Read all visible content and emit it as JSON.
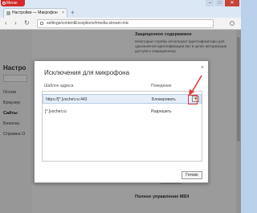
{
  "window": {
    "menu_label": "Меню",
    "min_glyph": "–",
    "max_glyph": "□",
    "close_glyph": "✕"
  },
  "tab": {
    "title": "Настройки — Микрофон",
    "close_glyph": "×"
  },
  "newtab_glyph": "+",
  "address": {
    "back_glyph": "‹",
    "forward_glyph": "›",
    "reload_glyph": "↻",
    "url": "settings/contentExceptions#media-stream-mic"
  },
  "sidebar": {
    "title": "Настро",
    "items": [
      "Основ",
      "Браузер",
      "Сайты",
      "Безопас",
      "Справка О"
    ],
    "active_index": 2
  },
  "content": {
    "heading": "Защищенное содержимое",
    "text": "Некоторые службы используют идентификаторы для однозначной идентификации вас в целях авторизации доступа к защищенному",
    "bottom_heading": "Полное управление MIDI"
  },
  "dialog": {
    "title": "Исключения для микрофона",
    "close_glyph": "×",
    "col_address": "Шаблон адреса",
    "col_behavior": "Поведение",
    "rows": [
      {
        "address": "https://[*.]vochet.ru:443",
        "behavior": "Блокировать",
        "selected": true,
        "edit_glyph": "▾"
      },
      {
        "address": "[*.]vochet.ru",
        "behavior": "Разрешить",
        "selected": false
      }
    ],
    "done_label": "Готово"
  },
  "colors": {
    "accent": "#e03a3a",
    "selection": "#e5eef9",
    "overlay": "rgba(0,0,0,0.38)"
  }
}
